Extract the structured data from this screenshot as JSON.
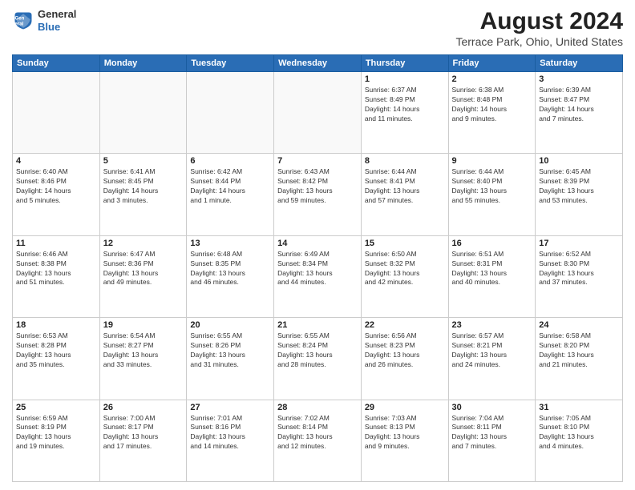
{
  "header": {
    "logo_line1": "General",
    "logo_line2": "Blue",
    "title": "August 2024",
    "subtitle": "Terrace Park, Ohio, United States"
  },
  "weekdays": [
    "Sunday",
    "Monday",
    "Tuesday",
    "Wednesday",
    "Thursday",
    "Friday",
    "Saturday"
  ],
  "weeks": [
    [
      {
        "day": "",
        "info": ""
      },
      {
        "day": "",
        "info": ""
      },
      {
        "day": "",
        "info": ""
      },
      {
        "day": "",
        "info": ""
      },
      {
        "day": "1",
        "info": "Sunrise: 6:37 AM\nSunset: 8:49 PM\nDaylight: 14 hours\nand 11 minutes."
      },
      {
        "day": "2",
        "info": "Sunrise: 6:38 AM\nSunset: 8:48 PM\nDaylight: 14 hours\nand 9 minutes."
      },
      {
        "day": "3",
        "info": "Sunrise: 6:39 AM\nSunset: 8:47 PM\nDaylight: 14 hours\nand 7 minutes."
      }
    ],
    [
      {
        "day": "4",
        "info": "Sunrise: 6:40 AM\nSunset: 8:46 PM\nDaylight: 14 hours\nand 5 minutes."
      },
      {
        "day": "5",
        "info": "Sunrise: 6:41 AM\nSunset: 8:45 PM\nDaylight: 14 hours\nand 3 minutes."
      },
      {
        "day": "6",
        "info": "Sunrise: 6:42 AM\nSunset: 8:44 PM\nDaylight: 14 hours\nand 1 minute."
      },
      {
        "day": "7",
        "info": "Sunrise: 6:43 AM\nSunset: 8:42 PM\nDaylight: 13 hours\nand 59 minutes."
      },
      {
        "day": "8",
        "info": "Sunrise: 6:44 AM\nSunset: 8:41 PM\nDaylight: 13 hours\nand 57 minutes."
      },
      {
        "day": "9",
        "info": "Sunrise: 6:44 AM\nSunset: 8:40 PM\nDaylight: 13 hours\nand 55 minutes."
      },
      {
        "day": "10",
        "info": "Sunrise: 6:45 AM\nSunset: 8:39 PM\nDaylight: 13 hours\nand 53 minutes."
      }
    ],
    [
      {
        "day": "11",
        "info": "Sunrise: 6:46 AM\nSunset: 8:38 PM\nDaylight: 13 hours\nand 51 minutes."
      },
      {
        "day": "12",
        "info": "Sunrise: 6:47 AM\nSunset: 8:36 PM\nDaylight: 13 hours\nand 49 minutes."
      },
      {
        "day": "13",
        "info": "Sunrise: 6:48 AM\nSunset: 8:35 PM\nDaylight: 13 hours\nand 46 minutes."
      },
      {
        "day": "14",
        "info": "Sunrise: 6:49 AM\nSunset: 8:34 PM\nDaylight: 13 hours\nand 44 minutes."
      },
      {
        "day": "15",
        "info": "Sunrise: 6:50 AM\nSunset: 8:32 PM\nDaylight: 13 hours\nand 42 minutes."
      },
      {
        "day": "16",
        "info": "Sunrise: 6:51 AM\nSunset: 8:31 PM\nDaylight: 13 hours\nand 40 minutes."
      },
      {
        "day": "17",
        "info": "Sunrise: 6:52 AM\nSunset: 8:30 PM\nDaylight: 13 hours\nand 37 minutes."
      }
    ],
    [
      {
        "day": "18",
        "info": "Sunrise: 6:53 AM\nSunset: 8:28 PM\nDaylight: 13 hours\nand 35 minutes."
      },
      {
        "day": "19",
        "info": "Sunrise: 6:54 AM\nSunset: 8:27 PM\nDaylight: 13 hours\nand 33 minutes."
      },
      {
        "day": "20",
        "info": "Sunrise: 6:55 AM\nSunset: 8:26 PM\nDaylight: 13 hours\nand 31 minutes."
      },
      {
        "day": "21",
        "info": "Sunrise: 6:55 AM\nSunset: 8:24 PM\nDaylight: 13 hours\nand 28 minutes."
      },
      {
        "day": "22",
        "info": "Sunrise: 6:56 AM\nSunset: 8:23 PM\nDaylight: 13 hours\nand 26 minutes."
      },
      {
        "day": "23",
        "info": "Sunrise: 6:57 AM\nSunset: 8:21 PM\nDaylight: 13 hours\nand 24 minutes."
      },
      {
        "day": "24",
        "info": "Sunrise: 6:58 AM\nSunset: 8:20 PM\nDaylight: 13 hours\nand 21 minutes."
      }
    ],
    [
      {
        "day": "25",
        "info": "Sunrise: 6:59 AM\nSunset: 8:19 PM\nDaylight: 13 hours\nand 19 minutes."
      },
      {
        "day": "26",
        "info": "Sunrise: 7:00 AM\nSunset: 8:17 PM\nDaylight: 13 hours\nand 17 minutes."
      },
      {
        "day": "27",
        "info": "Sunrise: 7:01 AM\nSunset: 8:16 PM\nDaylight: 13 hours\nand 14 minutes."
      },
      {
        "day": "28",
        "info": "Sunrise: 7:02 AM\nSunset: 8:14 PM\nDaylight: 13 hours\nand 12 minutes."
      },
      {
        "day": "29",
        "info": "Sunrise: 7:03 AM\nSunset: 8:13 PM\nDaylight: 13 hours\nand 9 minutes."
      },
      {
        "day": "30",
        "info": "Sunrise: 7:04 AM\nSunset: 8:11 PM\nDaylight: 13 hours\nand 7 minutes."
      },
      {
        "day": "31",
        "info": "Sunrise: 7:05 AM\nSunset: 8:10 PM\nDaylight: 13 hours\nand 4 minutes."
      }
    ]
  ]
}
